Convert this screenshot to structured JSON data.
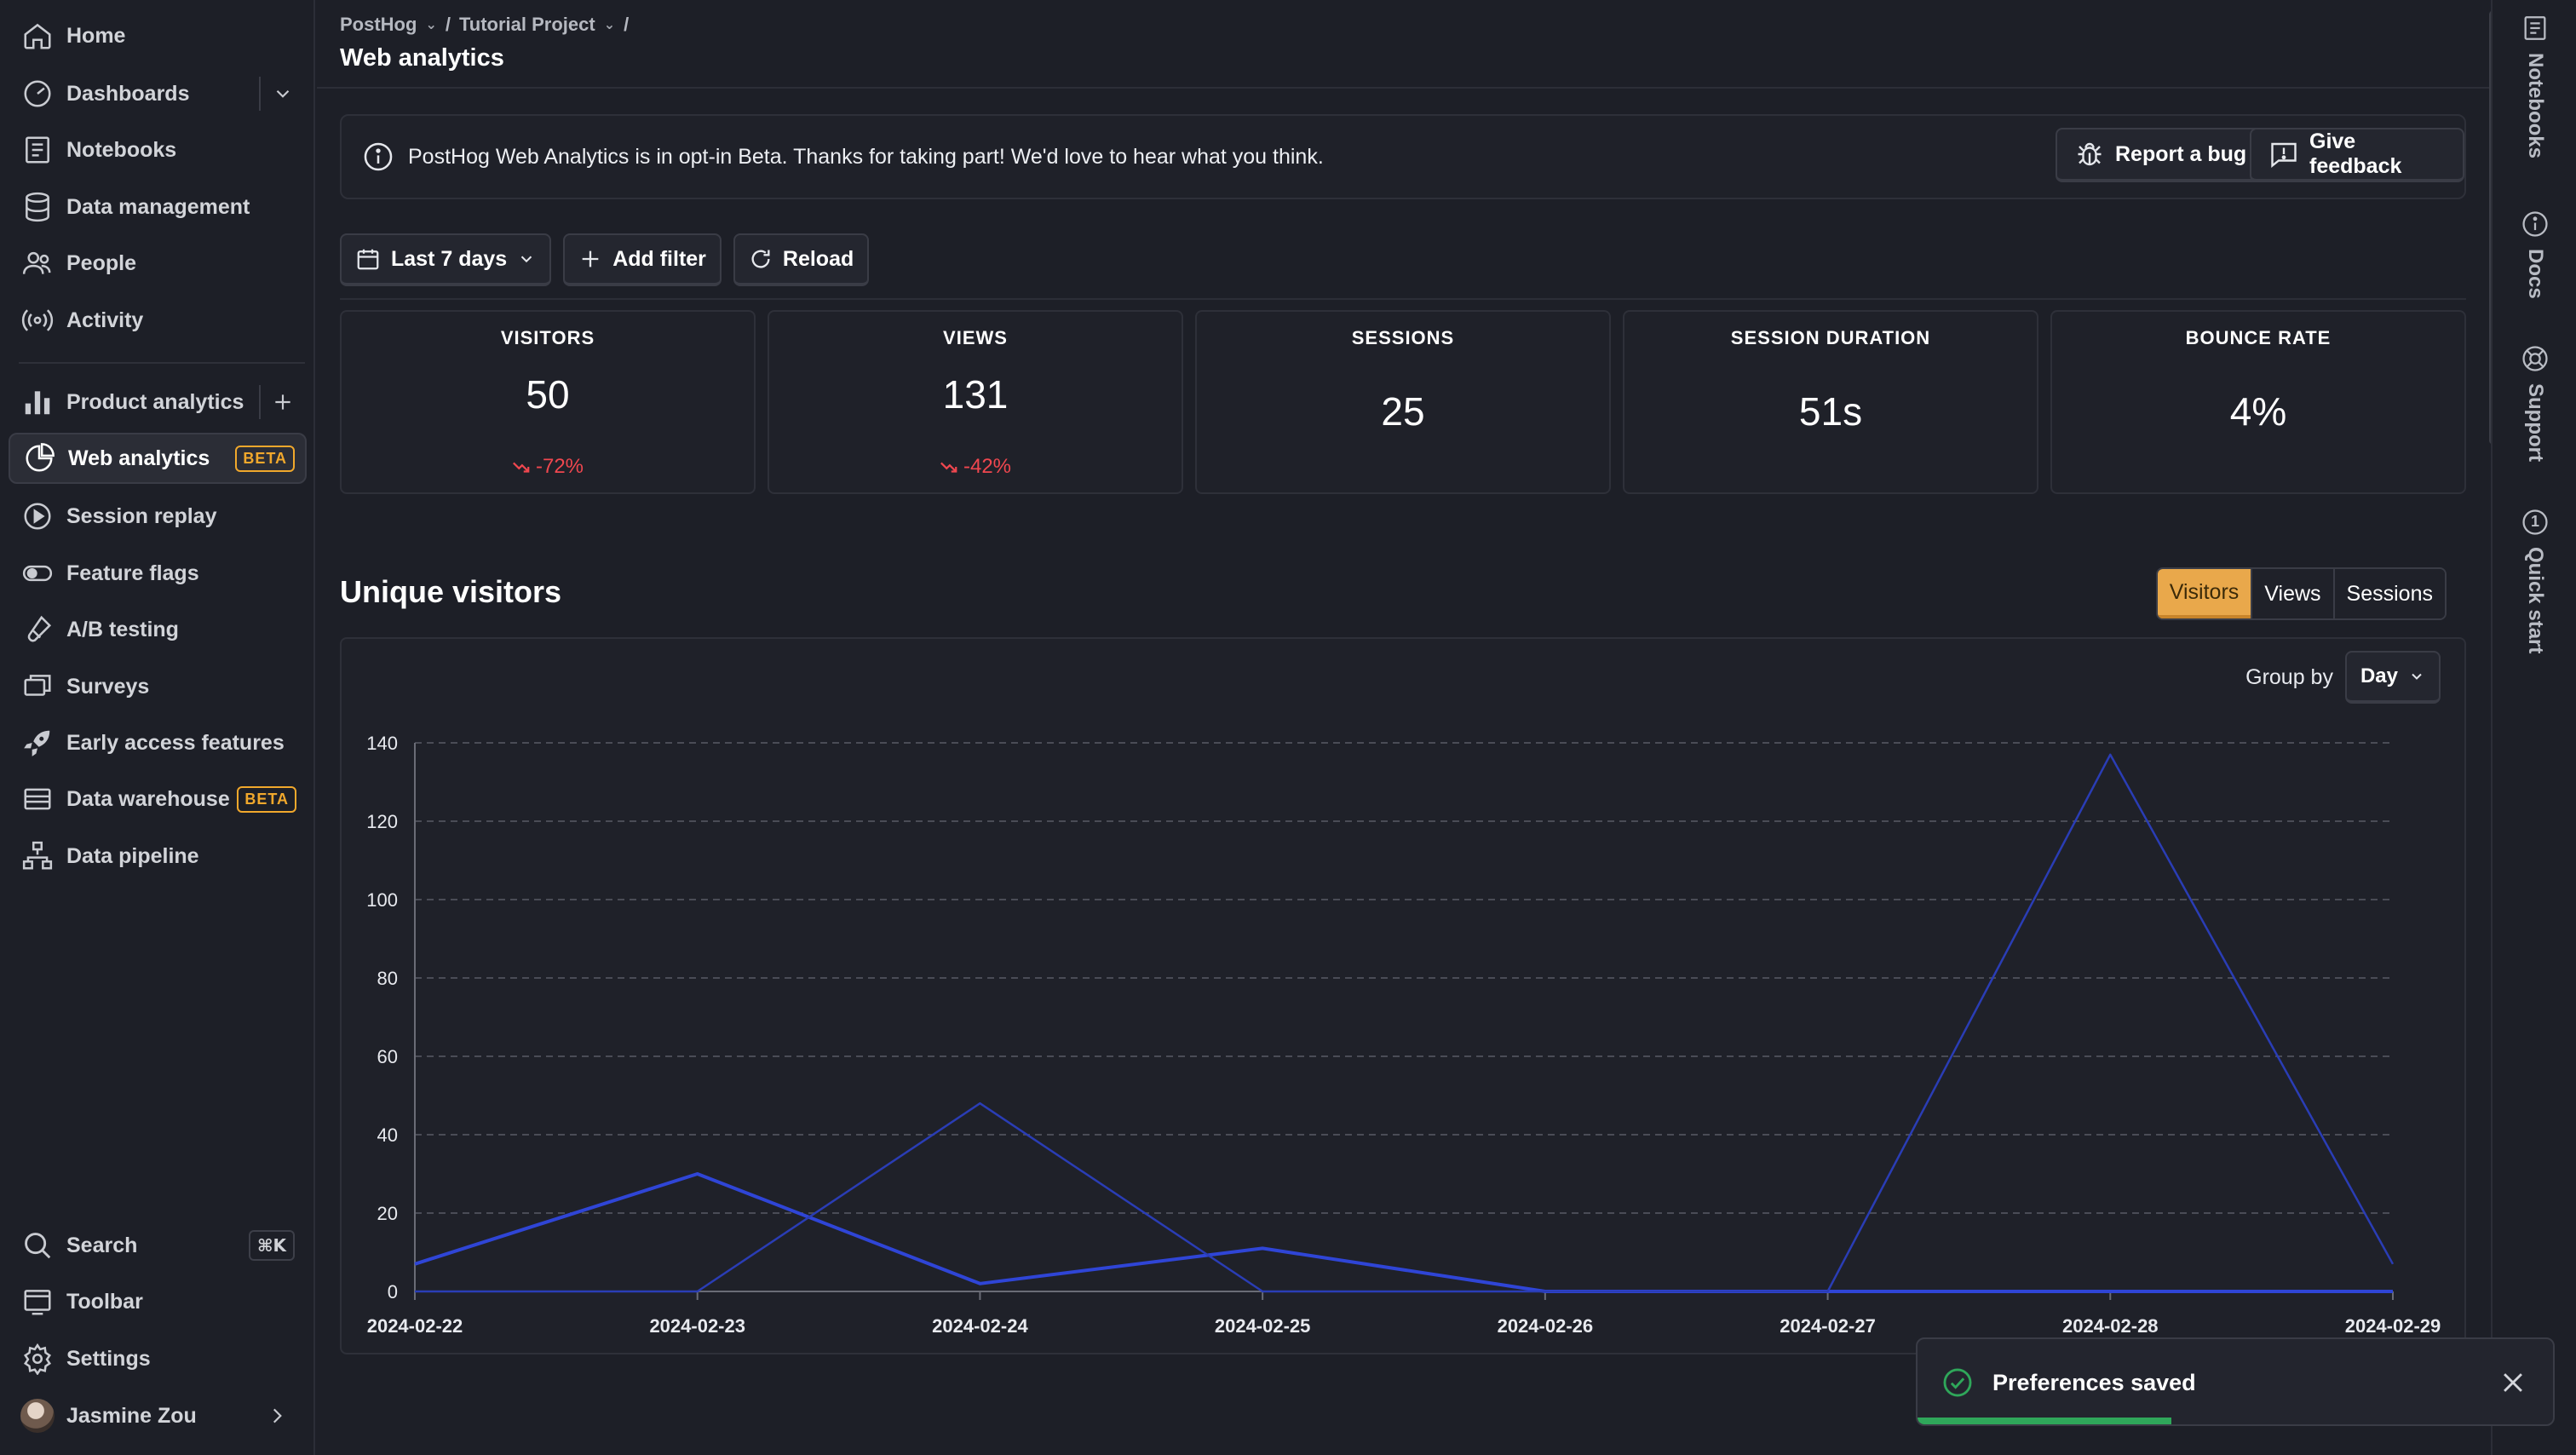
{
  "sidebar": {
    "items": [
      {
        "label": "Home",
        "icon": "home-icon"
      },
      {
        "label": "Dashboards",
        "icon": "dashboard-icon"
      },
      {
        "label": "Notebooks",
        "icon": "notebook-icon"
      },
      {
        "label": "Data management",
        "icon": "database-icon"
      },
      {
        "label": "People",
        "icon": "people-icon"
      },
      {
        "label": "Activity",
        "icon": "activity-icon"
      },
      {
        "label": "Product analytics",
        "icon": "bar-chart-icon"
      },
      {
        "label": "Web analytics",
        "icon": "pie-chart-icon",
        "badge": "BETA",
        "active": true
      },
      {
        "label": "Session replay",
        "icon": "play-icon"
      },
      {
        "label": "Feature flags",
        "icon": "toggle-icon"
      },
      {
        "label": "A/B testing",
        "icon": "flask-icon"
      },
      {
        "label": "Surveys",
        "icon": "survey-icon"
      },
      {
        "label": "Early access features",
        "icon": "rocket-icon"
      },
      {
        "label": "Data warehouse",
        "icon": "warehouse-icon",
        "badge": "BETA"
      },
      {
        "label": "Data pipeline",
        "icon": "pipeline-icon"
      }
    ],
    "bottom": {
      "search": "Search",
      "search_shortcut": "⌘K",
      "toolbar": "Toolbar",
      "settings": "Settings",
      "user": "Jasmine Zou"
    }
  },
  "header": {
    "breadcrumb": [
      "PostHog",
      "Tutorial Project"
    ],
    "title": "Web analytics"
  },
  "banner": {
    "text": "PostHog Web Analytics is in opt-in Beta. Thanks for taking part! We'd love to hear what you think.",
    "report_bug": "Report a bug",
    "give_feedback": "Give feedback"
  },
  "filters": {
    "date_range": "Last 7 days",
    "add_filter": "Add filter",
    "reload": "Reload"
  },
  "stats": [
    {
      "label": "VISITORS",
      "value": "50",
      "change": "-72%"
    },
    {
      "label": "VIEWS",
      "value": "131",
      "change": "-42%"
    },
    {
      "label": "SESSIONS",
      "value": "25",
      "change": ""
    },
    {
      "label": "SESSION DURATION",
      "value": "51s",
      "change": ""
    },
    {
      "label": "BOUNCE RATE",
      "value": "4%",
      "change": ""
    }
  ],
  "section": {
    "title": "Unique visitors",
    "tabs": [
      "Visitors",
      "Views",
      "Sessions"
    ],
    "active_tab": "Visitors",
    "group_by_label": "Group by",
    "group_by_value": "Day"
  },
  "chart_data": {
    "type": "line",
    "x": [
      "2024-02-22",
      "2024-02-23",
      "2024-02-24",
      "2024-02-25",
      "2024-02-26",
      "2024-02-27",
      "2024-02-28",
      "2024-02-29"
    ],
    "ylim": [
      0,
      140
    ],
    "yticks": [
      0,
      20,
      40,
      60,
      80,
      100,
      120,
      140
    ],
    "grid": true,
    "series": [
      {
        "values": [
          7,
          30,
          2,
          11,
          0,
          0,
          0,
          0
        ],
        "color": "#2f45d6",
        "stroke_weight": "bold"
      },
      {
        "values": [
          0,
          0,
          48,
          0,
          0,
          0,
          137,
          7
        ],
        "color": "#2a3db5",
        "stroke_weight": "thin"
      }
    ]
  },
  "rail": {
    "items": [
      {
        "label": "Notebooks",
        "icon": "notebook-icon"
      },
      {
        "label": "Docs",
        "icon": "info-icon"
      },
      {
        "label": "Support",
        "icon": "lifebuoy-icon"
      },
      {
        "label": "Quick start",
        "icon": "number-badge-icon",
        "badge": "1"
      }
    ]
  },
  "toast": {
    "text": "Preferences saved",
    "progress": 0.4
  },
  "colors": {
    "accent": "#e9a84b",
    "negative": "#f0474f",
    "success": "#2fa75a",
    "beta": "#f1a82c"
  }
}
